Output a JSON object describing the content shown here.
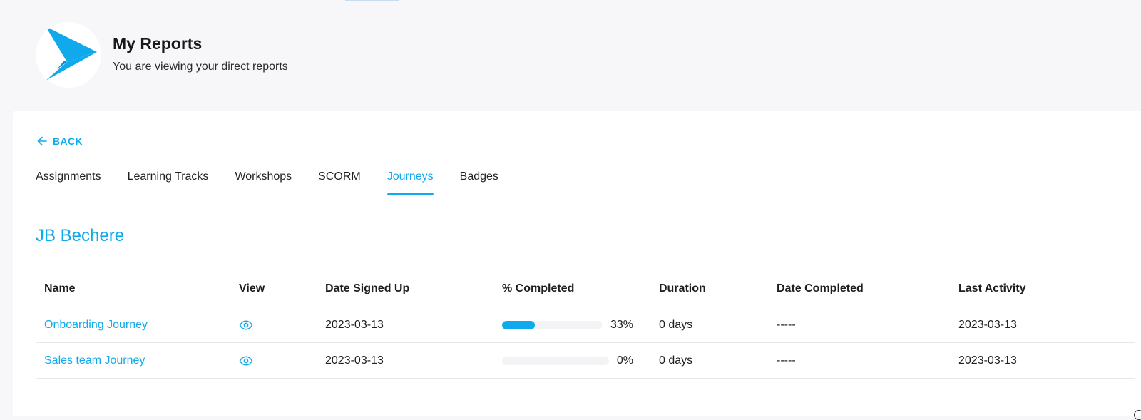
{
  "header": {
    "title": "My Reports",
    "subtitle": "You are viewing your direct reports",
    "logo_icon": "paper-plane-arrow-logo",
    "brand_color": "#10aaec"
  },
  "back": {
    "label": "BACK",
    "icon": "arrow-left-icon"
  },
  "tabs": [
    {
      "label": "Assignments",
      "active": false
    },
    {
      "label": "Learning Tracks",
      "active": false
    },
    {
      "label": "Workshops",
      "active": false
    },
    {
      "label": "SCORM",
      "active": false
    },
    {
      "label": "Journeys",
      "active": true
    },
    {
      "label": "Badges",
      "active": false
    }
  ],
  "person": {
    "name": "JB Bechere"
  },
  "table": {
    "columns": [
      "Name",
      "View",
      "Date Signed Up",
      "% Completed",
      "Duration",
      "Date Completed",
      "Last Activity"
    ],
    "rows": [
      {
        "name": "Onboarding Journey",
        "view_icon": "eye-icon",
        "date_signed_up": "2023-03-13",
        "percent_completed": "33%",
        "progress": 33,
        "duration": "0 days",
        "date_completed": "-----",
        "last_activity": "2023-03-13"
      },
      {
        "name": "Sales team Journey",
        "view_icon": "eye-icon",
        "date_signed_up": "2023-03-13",
        "percent_completed": "0%",
        "progress": 0,
        "duration": "0 days",
        "date_completed": "-----",
        "last_activity": "2023-03-13"
      }
    ]
  }
}
